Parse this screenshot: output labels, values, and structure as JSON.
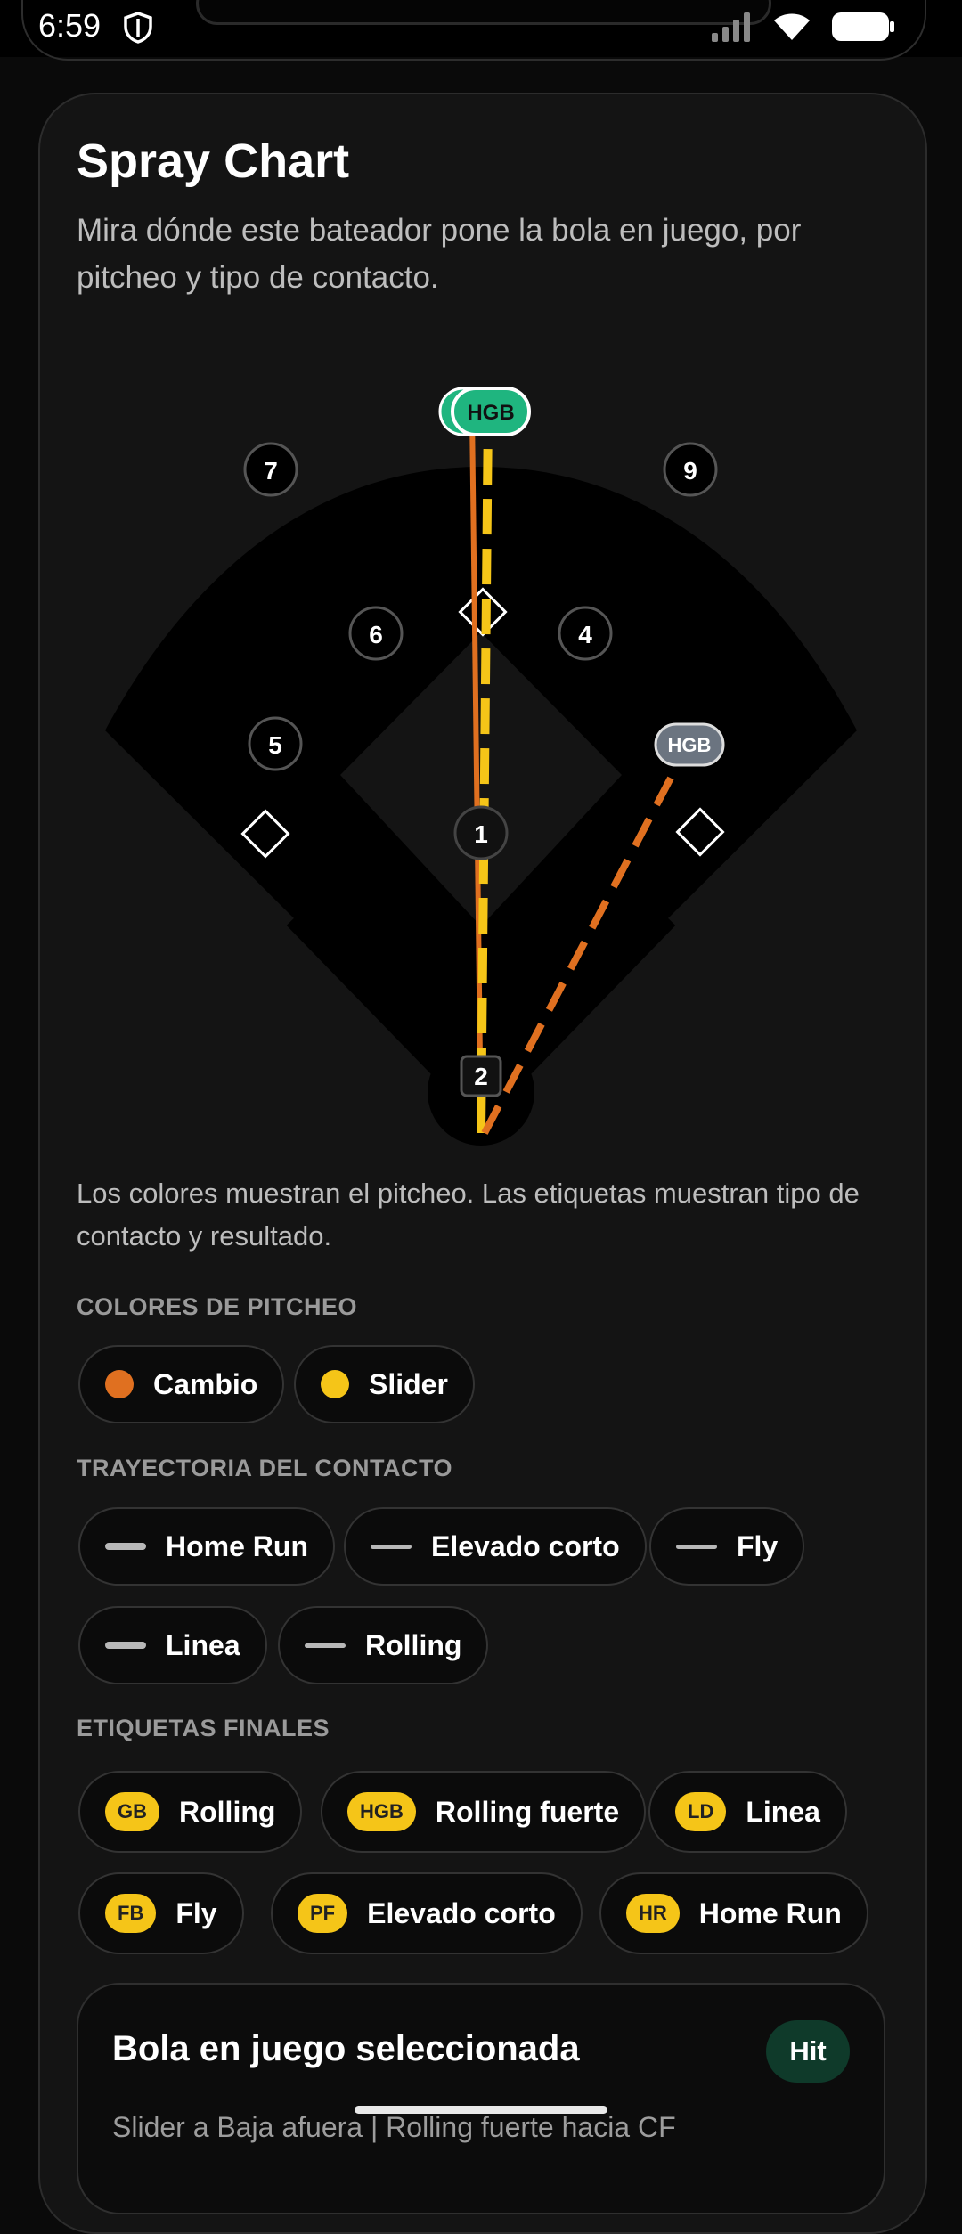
{
  "status_bar": {
    "time": "6:59"
  },
  "card": {
    "title": "Spray Chart",
    "subtitle": "Mira dónde este bateador pone la bola en juego, por pitcheo y tipo de contacto."
  },
  "field": {
    "positions": [
      "7",
      "9",
      "6",
      "4",
      "5",
      "1",
      "2"
    ],
    "hit_labels": [
      "HGB",
      "HGB"
    ]
  },
  "caption": "Los colores muestran el pitcheo. Las etiquetas muestran tipo de contacto y resultado.",
  "pitch_colors": {
    "heading": "COLORES DE PITCHEO",
    "items": [
      {
        "label": "Cambio",
        "color": "#e07020"
      },
      {
        "label": "Slider",
        "color": "#f5c518"
      }
    ]
  },
  "trajectory": {
    "heading": "TRAYECTORIA DEL CONTACTO",
    "items": [
      "Home Run",
      "Elevado corto",
      "Fly",
      "Linea",
      "Rolling"
    ]
  },
  "final_labels": {
    "heading": "ETIQUETAS FINALES",
    "items": [
      {
        "tag": "GB",
        "label": "Rolling"
      },
      {
        "tag": "HGB",
        "label": "Rolling fuerte"
      },
      {
        "tag": "LD",
        "label": "Linea"
      },
      {
        "tag": "FB",
        "label": "Fly"
      },
      {
        "tag": "PF",
        "label": "Elevado corto"
      },
      {
        "tag": "HR",
        "label": "Home Run"
      }
    ]
  },
  "selected": {
    "title": "Bola en juego seleccionada",
    "badge": "Hit",
    "description": "Slider a Baja afuera | Rolling fuerte hacia CF"
  },
  "colors": {
    "accent_green": "#1fb57f",
    "cambio": "#e07020",
    "slider": "#f5c518",
    "tag_gray": "#6b7480"
  }
}
